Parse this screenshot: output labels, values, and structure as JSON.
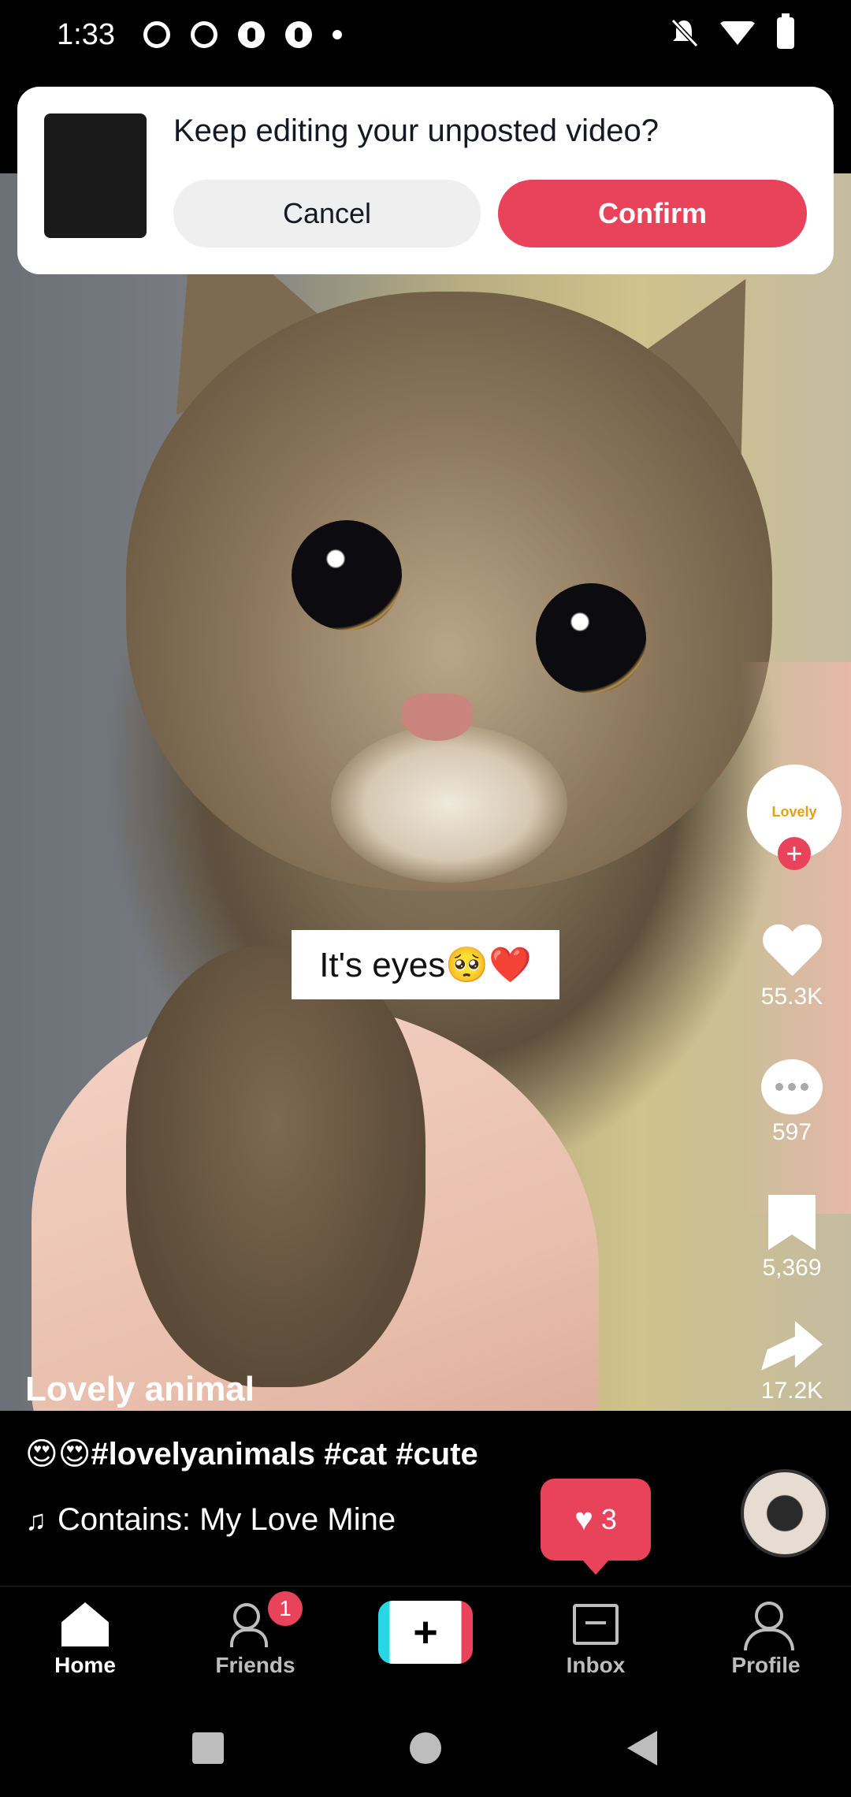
{
  "status_bar": {
    "time": "1:33",
    "icons": [
      "threads-icon",
      "record-icon",
      "pinterest-icon",
      "pinterest-icon",
      "dot-icon",
      "bell-off-icon",
      "wifi-icon",
      "battery-charging-icon"
    ]
  },
  "dialog": {
    "title": "Keep editing your unposted video?",
    "cancel_label": "Cancel",
    "confirm_label": "Confirm"
  },
  "video": {
    "caption_overlay": "It's eyes🥺❤️"
  },
  "actions": {
    "avatar_text": "Lovely",
    "follow_symbol": "+",
    "likes": "55.3K",
    "comments": "597",
    "saves": "5,369",
    "shares": "17.2K"
  },
  "post": {
    "username": "Lovely animal",
    "description": "😍😍#lovelyanimals #cat #cute",
    "music_note": "♫",
    "music": "Contains: My Love Mine"
  },
  "like_popup": {
    "icon": "♥",
    "count": "3"
  },
  "nav": {
    "home": "Home",
    "friends": "Friends",
    "friends_badge": "1",
    "create_symbol": "+",
    "inbox": "Inbox",
    "profile": "Profile"
  },
  "colors": {
    "accent": "#e8435a",
    "dialog_bg": "#ffffff",
    "nav_bg": "#000000"
  }
}
